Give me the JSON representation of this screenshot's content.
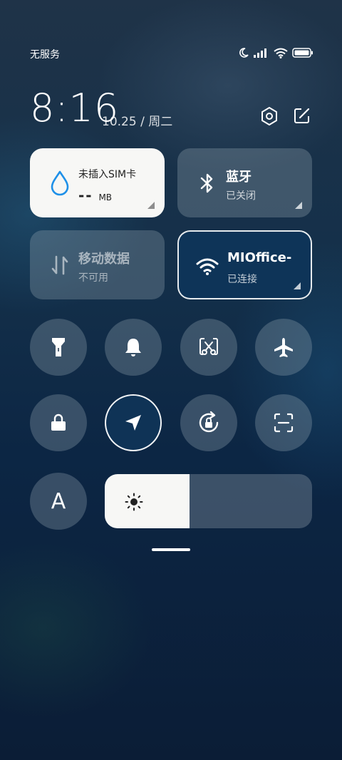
{
  "status_bar": {
    "carrier": "无服务",
    "icons": [
      "moon-icon",
      "signal-icon",
      "wifi-icon",
      "battery-icon"
    ]
  },
  "header": {
    "time": "8:16",
    "date": "10.25 / 周二",
    "icons": [
      "settings-icon",
      "edit-icon"
    ]
  },
  "tiles": {
    "sim": {
      "title": "未插入SIM卡",
      "value": "--",
      "unit": "MB",
      "icon": "water-drop-icon"
    },
    "bluetooth": {
      "title": "蓝牙",
      "status": "已关闭",
      "icon": "bluetooth-icon"
    },
    "mobile_data": {
      "title": "移动数据",
      "status": "不可用",
      "icon": "data-arrows-icon"
    },
    "wifi": {
      "title": "MIOffice-",
      "status": "已连接",
      "icon": "wifi-icon"
    }
  },
  "toggles": [
    {
      "name": "flashlight",
      "icon": "flashlight-icon",
      "active": false
    },
    {
      "name": "bell",
      "icon": "bell-icon",
      "active": false
    },
    {
      "name": "screenshot",
      "icon": "screenshot-scissors-icon",
      "active": false
    },
    {
      "name": "airplane",
      "icon": "airplane-icon",
      "active": false
    },
    {
      "name": "lock",
      "icon": "lock-icon",
      "active": false
    },
    {
      "name": "location",
      "icon": "location-arrow-icon",
      "active": true
    },
    {
      "name": "rotation-lock",
      "icon": "rotation-lock-icon",
      "active": false
    },
    {
      "name": "scan",
      "icon": "scan-icon",
      "active": false
    }
  ],
  "font_size_button": {
    "label": "A"
  },
  "brightness": {
    "level_percent": 41,
    "icon": "sun-icon"
  },
  "colors": {
    "tile_active_bg": "#0e3458",
    "sim_drop": "#1e90e8"
  }
}
